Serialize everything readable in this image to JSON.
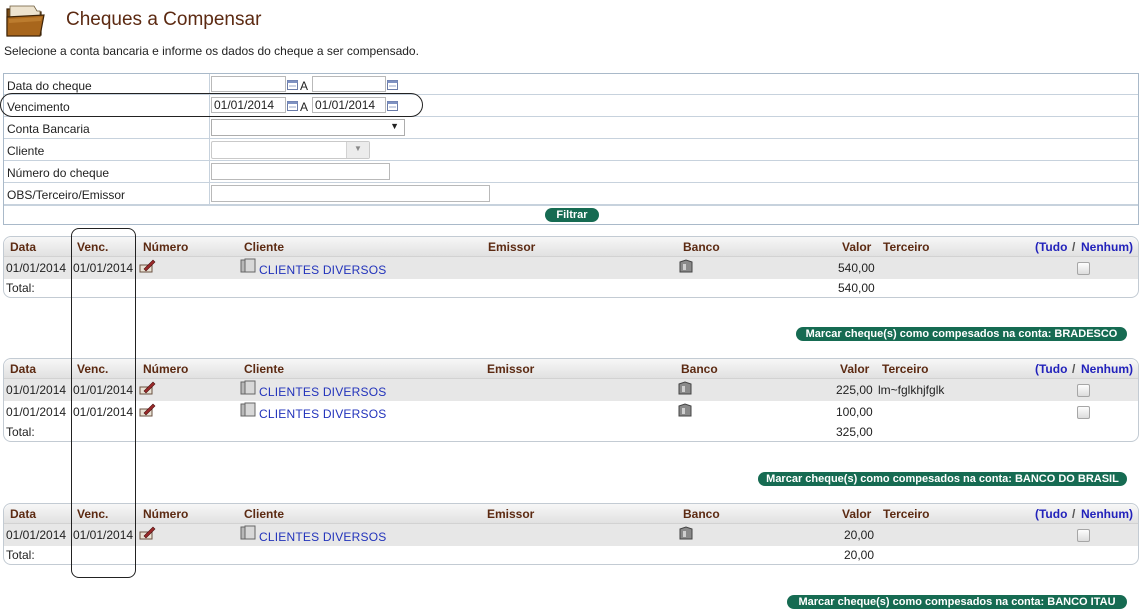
{
  "page": {
    "title": "Cheques a Compensar",
    "subtitle": "Selecione a conta bancaria e informe os dados do cheque a ser compensado."
  },
  "filter": {
    "data_cheque_label": "Data do cheque",
    "vencimento_label": "Vencimento",
    "conta_label": "Conta Bancaria",
    "cliente_label": "Cliente",
    "numero_label": "Número do cheque",
    "obs_label": "OBS/Terceiro/Emissor",
    "a_label": "A",
    "data_cheque_from": "",
    "data_cheque_to": "",
    "venc_from": "01/01/2014",
    "venc_to": "01/01/2014",
    "conta_value": "",
    "cliente_value": "",
    "numero_value": "",
    "obs_value": "",
    "filtrar_button": "Filtrar"
  },
  "columns": {
    "data": "Data",
    "venc": "Venc.",
    "numero": "Número",
    "cliente": "Cliente",
    "emissor": "Emissor",
    "banco": "Banco",
    "valor": "Valor",
    "terceiro": "Terceiro",
    "tudo": "(Tudo",
    "slash": "/",
    "nenhum": "Nenhum)"
  },
  "total_label": "Total:",
  "groups": [
    {
      "rows": [
        {
          "data": "01/01/2014",
          "venc": "01/01/2014",
          "cliente": "CLIENTES DIVERSOS",
          "valor": "540,00",
          "terceiro": ""
        }
      ],
      "total": "540,00",
      "action_button": "Marcar cheque(s) como compesados na conta: BRADESCO"
    },
    {
      "rows": [
        {
          "data": "01/01/2014",
          "venc": "01/01/2014",
          "cliente": "CLIENTES DIVERSOS",
          "valor": "225,00",
          "terceiro": "lm~fglkhjfglk"
        },
        {
          "data": "01/01/2014",
          "venc": "01/01/2014",
          "cliente": "CLIENTES DIVERSOS",
          "valor": "100,00",
          "terceiro": ""
        }
      ],
      "total": "325,00",
      "action_button": "Marcar cheque(s) como compesados na conta: BANCO DO BRASIL"
    },
    {
      "rows": [
        {
          "data": "01/01/2014",
          "venc": "01/01/2014",
          "cliente": "CLIENTES DIVERSOS",
          "valor": "20,00",
          "terceiro": ""
        }
      ],
      "total": "20,00",
      "action_button": "Marcar cheque(s) como compesados na conta: BANCO ITAU"
    }
  ],
  "icons": {
    "header": "folder-icon",
    "calendar": "calendar-icon",
    "numero": "cheque-edit-icon",
    "cliente": "client-folder-icon",
    "banco": "bank-icon",
    "select": "chevron-down-icon"
  },
  "colors": {
    "title": "#5c2a12",
    "header_text": "#5c2a12",
    "link": "#2233bb",
    "button": "#166b52",
    "row_alt": "#e7e7e7"
  }
}
